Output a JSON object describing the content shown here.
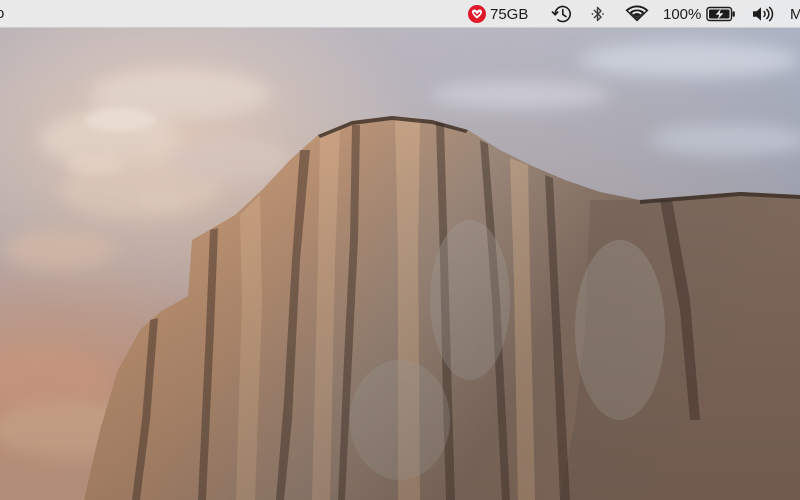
{
  "menubar": {
    "left_fragment": "o",
    "disk_monitor": {
      "icon": "heart-icon",
      "label": "75GB",
      "color": "#e1172a"
    },
    "time_machine": {
      "icon": "time-machine-icon"
    },
    "bluetooth": {
      "icon": "bluetooth-icon"
    },
    "wifi": {
      "icon": "wifi-icon"
    },
    "battery": {
      "percent_label": "100%",
      "icon": "battery-charging-icon"
    },
    "volume": {
      "icon": "volume-icon"
    },
    "user_fragment": "M"
  },
  "desktop": {
    "wallpaper": "granite-cliff-wallpaper",
    "colors": {
      "sky_top": "#aab2c4",
      "sky_glow": "#e9c2a8",
      "rock_light": "#d4a47c",
      "rock_dark": "#6b5648"
    }
  }
}
